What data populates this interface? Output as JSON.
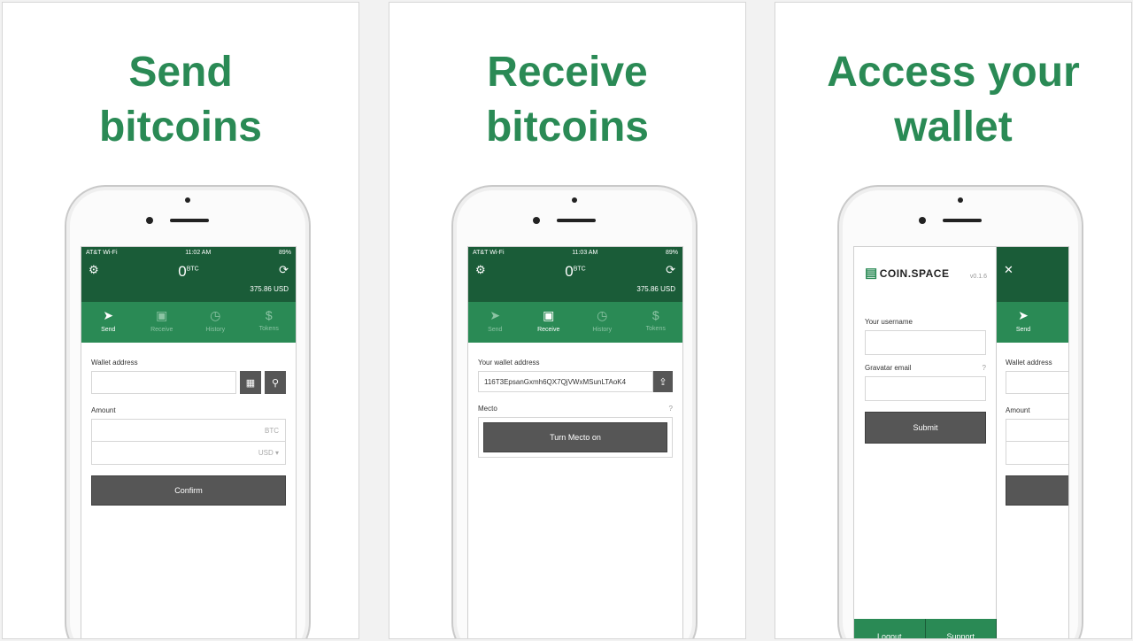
{
  "panels": [
    {
      "headline": [
        "Send",
        "bitcoins"
      ]
    },
    {
      "headline": [
        "Receive",
        "bitcoins"
      ]
    },
    {
      "headline": [
        "Access your",
        "wallet"
      ]
    }
  ],
  "status": {
    "carrier": "AT&T Wi-Fi",
    "time1": "11:02 AM",
    "time2": "11:03 AM",
    "battery": "89%"
  },
  "header": {
    "balance": "0",
    "unit": "BTC",
    "usd": "375.86 USD"
  },
  "tabs": [
    "Send",
    "Receive",
    "History",
    "Tokens"
  ],
  "send": {
    "wallet_label": "Wallet address",
    "amount_label": "Amount",
    "btc_ph": "BTC",
    "usd_ph": "USD",
    "confirm": "Confirm"
  },
  "receive": {
    "wallet_label": "Your wallet address",
    "address": "116T3EpsanGxmh6QX7QjVWxMSunLTAoK4",
    "mecto_label": "Mecto",
    "mecto_btn": "Turn Mecto on"
  },
  "menu": {
    "brand": "COIN.SPACE",
    "version": "v0.1.6",
    "username_label": "Your username",
    "gravatar_label": "Gravatar email",
    "submit": "Submit",
    "logout": "Logout",
    "support": "Support"
  },
  "behind": {
    "tab": "Send",
    "wallet_label": "Wallet address",
    "amount_label": "Amount"
  }
}
